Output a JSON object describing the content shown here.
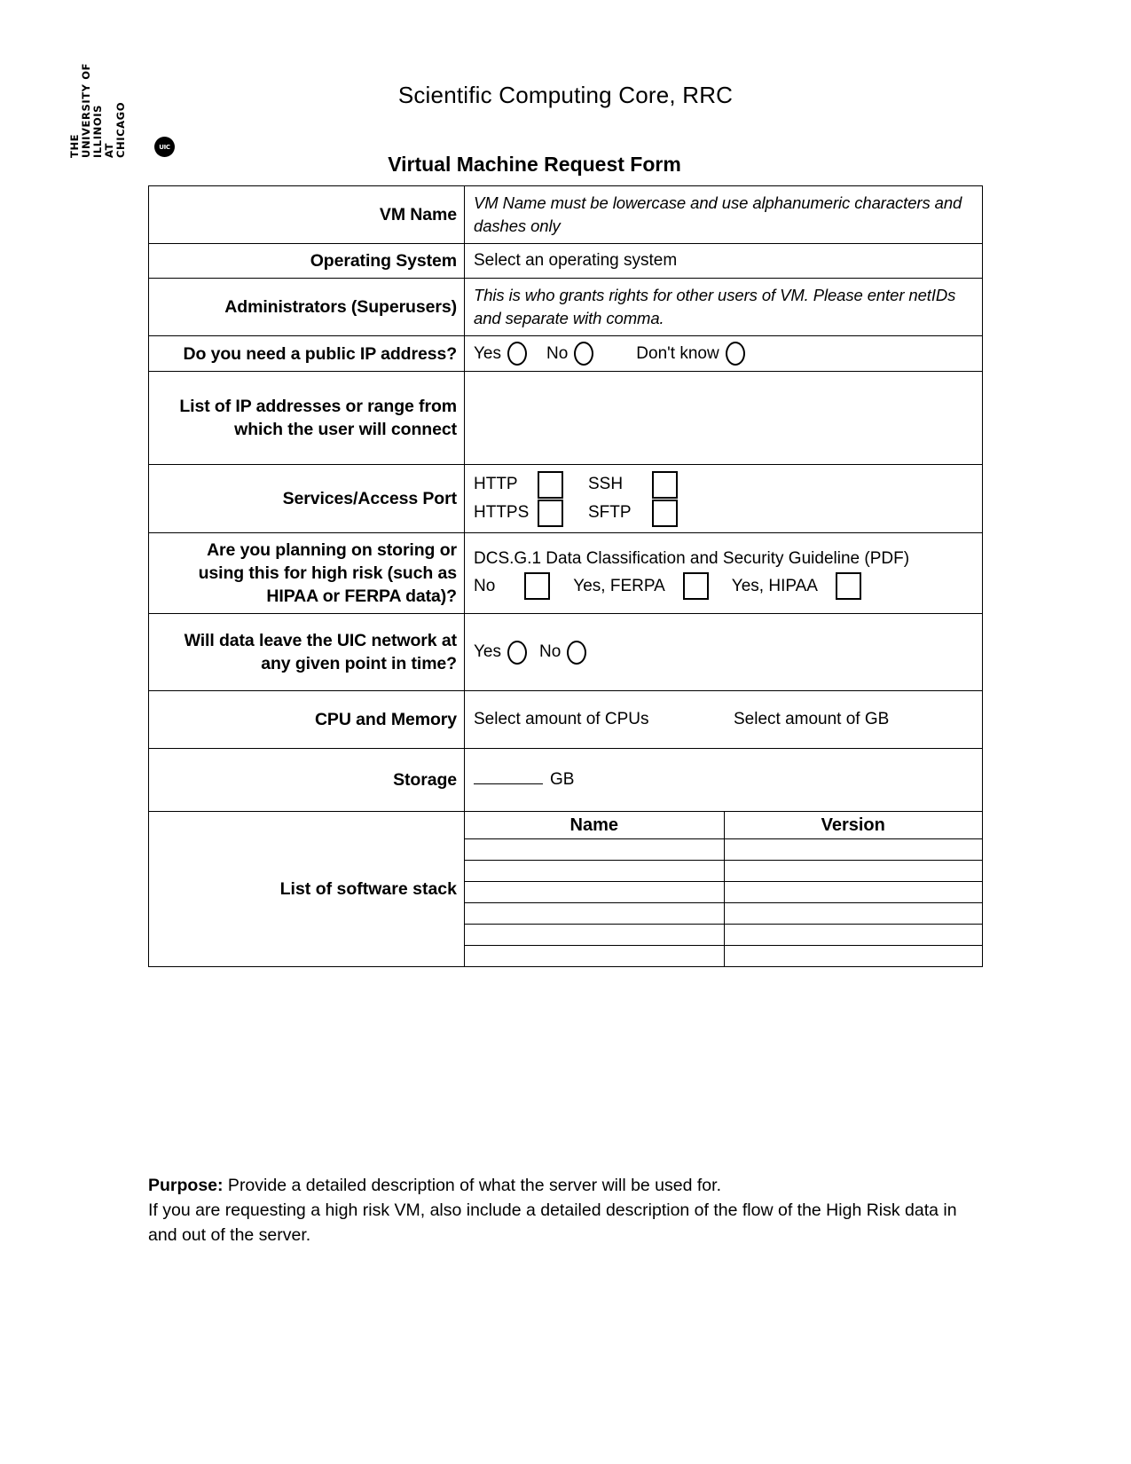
{
  "logo": {
    "lines": [
      "THE",
      "UNIVERSITY OF",
      "ILLINOIS",
      "AT",
      "CHICAGO"
    ],
    "seal_text": "UIC"
  },
  "header": {
    "org_title": "Scientific Computing Core, RRC",
    "form_title": "Virtual Machine Request Form"
  },
  "form": {
    "vm_name": {
      "label": "VM Name",
      "hint": "VM Name must be lowercase and use alphanumeric characters and dashes only"
    },
    "operating_system": {
      "label": "Operating System",
      "value": "Select an operating system"
    },
    "administrators": {
      "label": "Administrators (Superusers)",
      "hint": "This is who grants rights for other users of VM. Please enter netIDs and separate with comma."
    },
    "public_ip": {
      "label": "Do you need a public IP address?",
      "options": [
        "Yes",
        "No",
        "Don't know"
      ]
    },
    "ip_list": {
      "label": "List of IP addresses or range from which the user will connect",
      "value": ""
    },
    "services": {
      "label": "Services/Access Port",
      "options": [
        "HTTP",
        "SSH",
        "HTTPS",
        "SFTP"
      ]
    },
    "high_risk": {
      "label": "Are you planning on storing or using this for high risk (such as HIPAA or FERPA data)?",
      "guideline": "DCS.G.1 Data Classification and Security Guideline (PDF)",
      "options": [
        "No",
        "Yes, FERPA",
        "Yes, HIPAA"
      ]
    },
    "data_leave": {
      "label": "Will data leave the UIC network at any given point in time?",
      "options": [
        "Yes",
        "No"
      ]
    },
    "cpu_memory": {
      "label": "CPU and Memory",
      "cpu_value": "Select amount of CPUs",
      "memory_value": "Select amount of GB"
    },
    "storage": {
      "label": "Storage",
      "unit": "GB"
    },
    "software_stack": {
      "label": "List of software stack",
      "columns": [
        "Name",
        "Version"
      ],
      "rows": [
        {
          "name": "",
          "version": ""
        },
        {
          "name": "",
          "version": ""
        },
        {
          "name": "",
          "version": ""
        },
        {
          "name": "",
          "version": ""
        },
        {
          "name": "",
          "version": ""
        },
        {
          "name": "",
          "version": ""
        }
      ]
    }
  },
  "footer": {
    "purpose_label": "Purpose:",
    "purpose_text": " Provide a detailed description of what the server will be used for.",
    "note": "If you are requesting a high risk VM, also include a detailed description of the flow of the High Risk data in and out of the server."
  }
}
